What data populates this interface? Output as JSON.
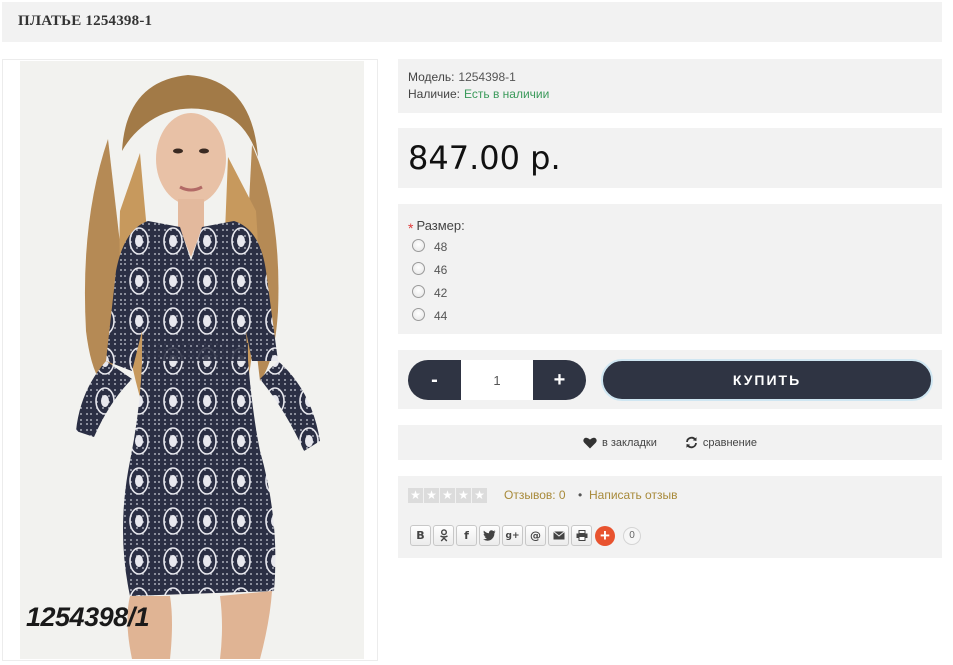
{
  "product": {
    "title": "ПЛАТЬЕ 1254398-1",
    "image_caption": "1254398/1",
    "model_label": "Модель:",
    "model_value": "1254398-1",
    "stock_label": "Наличие:",
    "stock_value": "Есть в наличии",
    "price": "847.00 р."
  },
  "options": {
    "size_label": "Размер:",
    "required_mark": "*",
    "sizes": [
      "48",
      "46",
      "42",
      "44"
    ]
  },
  "cart": {
    "minus_label": "-",
    "plus_label": "+",
    "quantity": "1",
    "buy_label": "КУПИТЬ"
  },
  "actions": {
    "bookmark_label": "в закладки",
    "bookmark_icon": "heart-icon",
    "compare_label": "сравнение",
    "compare_icon": "refresh-icon"
  },
  "reviews": {
    "rating": 0,
    "max_rating": 5,
    "reviews_text": "Отзывов: 0",
    "separator": "•",
    "write_review": "Написать отзыв"
  },
  "share": {
    "buttons": [
      "В",
      "ok-icon",
      "f",
      "twitter-icon",
      "g+",
      "@",
      "mail-icon",
      "print-icon"
    ],
    "count": "0"
  },
  "colors": {
    "panel_bg": "#f2f2f2",
    "button_dark": "#2f3443",
    "in_stock": "#3a9a5a",
    "link_gold": "#a88a3a",
    "share_plus": "#e8532f"
  }
}
